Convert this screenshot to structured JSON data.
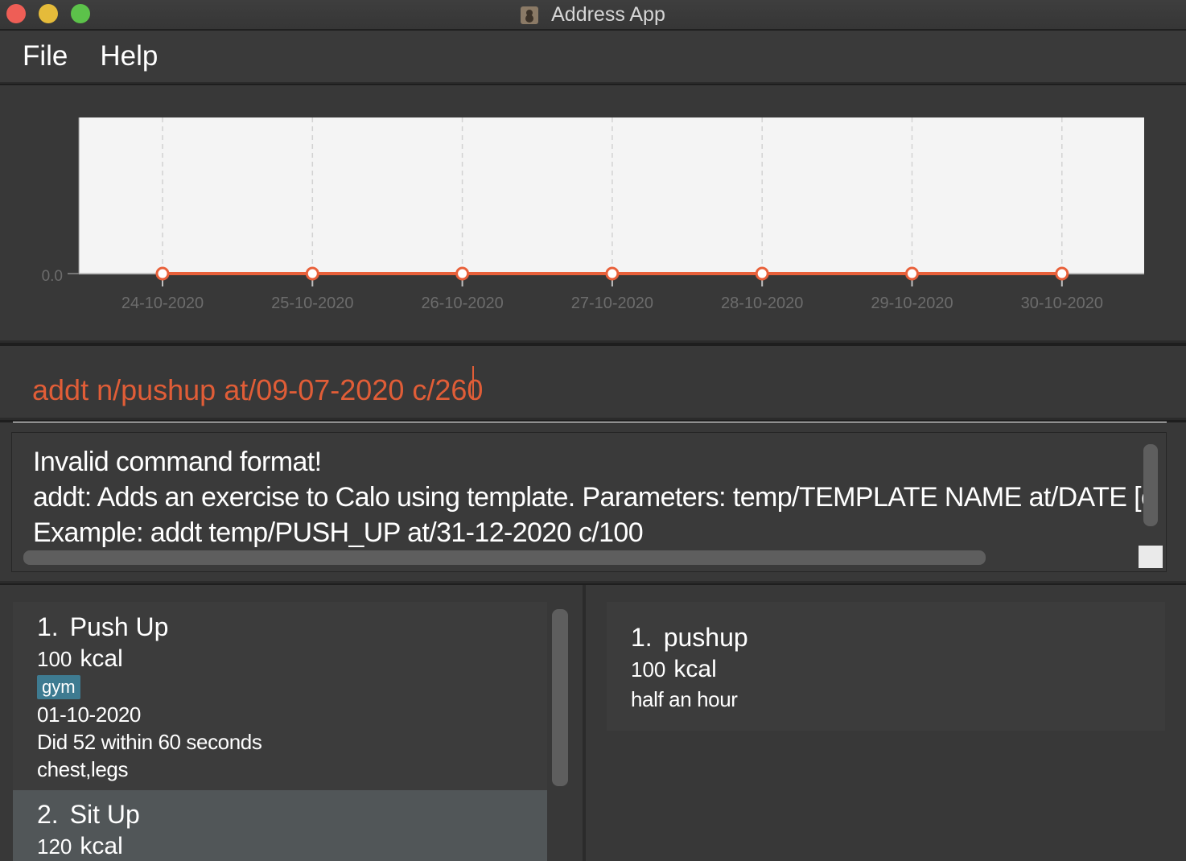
{
  "window": {
    "title": "Address App"
  },
  "menu": {
    "file": "File",
    "help": "Help"
  },
  "chart_data": {
    "type": "line",
    "categories": [
      "24-10-2020",
      "25-10-2020",
      "26-10-2020",
      "27-10-2020",
      "28-10-2020",
      "29-10-2020",
      "30-10-2020"
    ],
    "values": [
      0,
      0,
      0,
      0,
      0,
      0,
      0
    ],
    "y_tick_label": "0.0",
    "ylim": [
      0,
      1
    ],
    "grid": "vertical dashed",
    "colors": {
      "line": "#e8603a",
      "plot_background": "#f4f4f4",
      "tick_text": "#6c6c6c"
    }
  },
  "command": {
    "value": "addt n/pushup at/09-07-2020 c/260"
  },
  "result": {
    "lines": [
      "Invalid command format!",
      "addt: Adds an exercise to Calo using template. Parameters: temp/TEMPLATE NAME at/DATE [c",
      "Example: addt temp/PUSH_UP at/31-12-2020 c/100"
    ]
  },
  "exercises": [
    {
      "index": "1.",
      "name": "Push Up",
      "calories": "100",
      "unit": "kcal",
      "tag": "gym",
      "date": "01-10-2020",
      "description": "Did 52 within 60 seconds",
      "muscles": "chest,legs"
    },
    {
      "index": "2.",
      "name": "Sit Up",
      "calories": "120",
      "unit": "kcal"
    }
  ],
  "templates": [
    {
      "index": "1.",
      "name": "pushup",
      "calories": "100",
      "unit": "kcal",
      "duration": "half an hour"
    }
  ]
}
